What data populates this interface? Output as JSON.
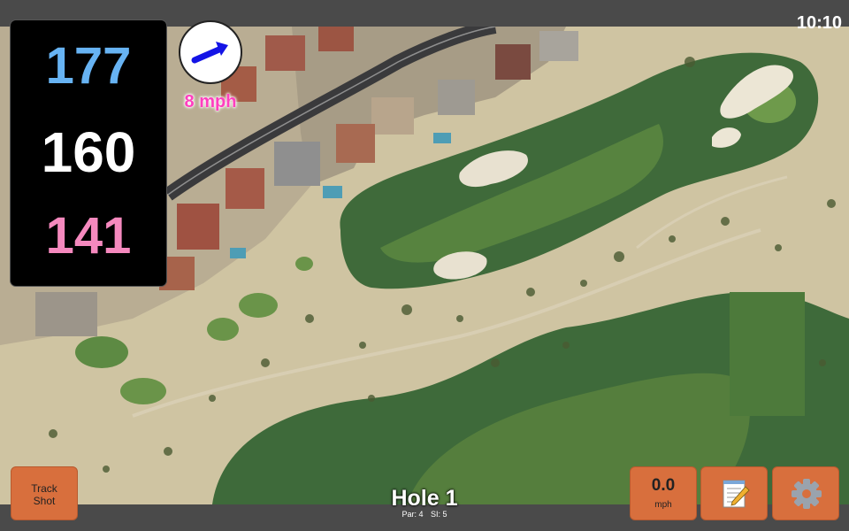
{
  "status": {
    "time": "10:10"
  },
  "distances": {
    "back": "177",
    "middle": "160",
    "front": "141"
  },
  "wind": {
    "speed": "8 mph",
    "arrow_icon": "arrow-right-icon"
  },
  "buttons": {
    "track_shot_line1": "Track",
    "track_shot_line2": "Shot",
    "speed_value": "0.0",
    "speed_unit": "mph",
    "notes_icon": "notepad-icon",
    "settings_icon": "gear-icon"
  },
  "hole": {
    "title": "Hole 1",
    "par": "Par: 4",
    "si": "SI: 5"
  },
  "colors": {
    "back_distance": "#67b3f3",
    "middle_distance": "#ffffff",
    "front_distance": "#f589be",
    "wind_text": "#ff3fbf",
    "button": "#d86f3d",
    "bar": "#4a4a4a"
  }
}
